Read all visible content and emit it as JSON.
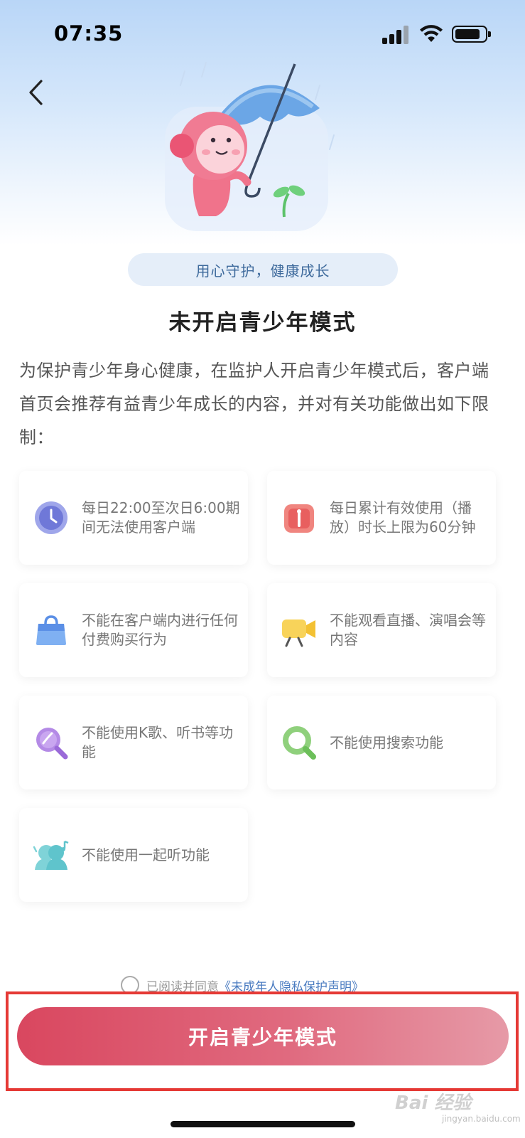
{
  "status_bar": {
    "time": "07:35"
  },
  "header": {
    "slogan": "用心守护，健康成长"
  },
  "main": {
    "title": "未开启青少年模式",
    "description": "为保护青少年身心健康，在监护人开启青少年模式后，客户端首页会推荐有益青少年成长的内容，并对有关功能做出如下限制："
  },
  "restrictions": [
    {
      "icon": "clock-icon",
      "text": "每日22:00至次日6:00期间无法使用客户端"
    },
    {
      "icon": "timer-limit-icon",
      "text": "每日累计有效使用（播放）时长上限为60分钟"
    },
    {
      "icon": "shopping-bag-icon",
      "text": "不能在客户端内进行任何付费购买行为"
    },
    {
      "icon": "video-camera-icon",
      "text": "不能观看直播、演唱会等内容"
    },
    {
      "icon": "microphone-icon",
      "text": "不能使用K歌、听书等功能"
    },
    {
      "icon": "search-icon",
      "text": "不能使用搜索功能"
    },
    {
      "icon": "listen-together-icon",
      "text": "不能使用一起听功能"
    }
  ],
  "agreement": {
    "prefix": "已阅读并同意",
    "link": "《未成年人隐私保护声明》"
  },
  "cta": {
    "label": "开启青少年模式"
  },
  "watermark": {
    "brand": "Bai 经验",
    "url": "jingyan.baidu.com"
  },
  "colors": {
    "accent": "#d9475f",
    "slogan_text": "#3e6a9c",
    "link": "#4a7bc0",
    "highlight_frame": "#e53935"
  }
}
